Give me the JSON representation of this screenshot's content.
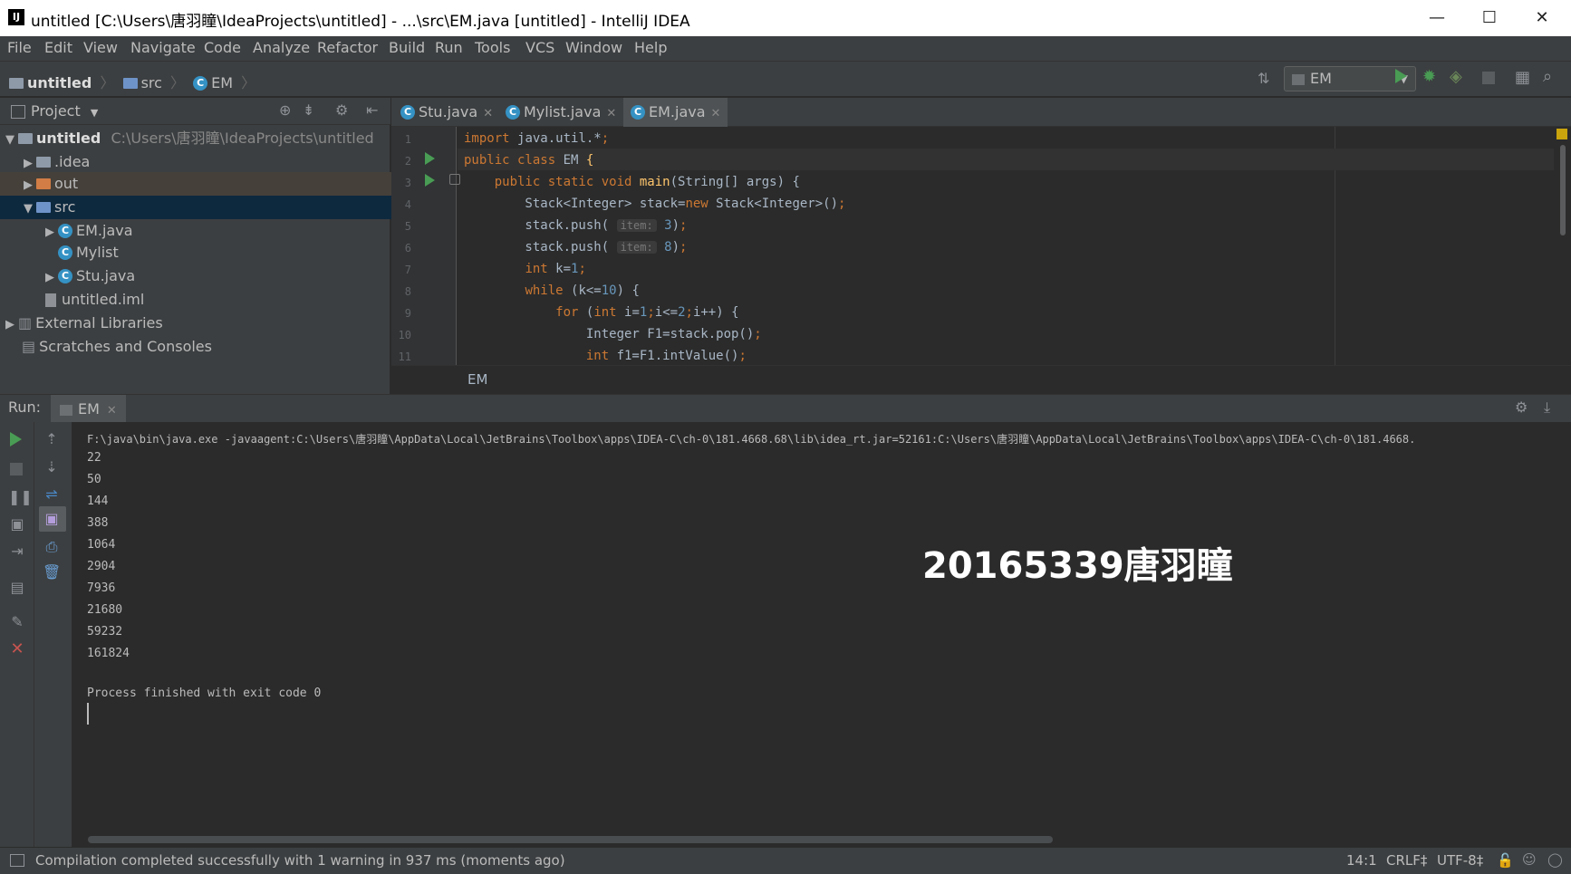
{
  "window": {
    "title": "untitled [C:\\Users\\唐羽瞳\\IdeaProjects\\untitled] - ...\\src\\EM.java [untitled] - IntelliJ IDEA",
    "minimize": "—",
    "maximize": "☐",
    "close": "✕"
  },
  "menu": [
    "File",
    "Edit",
    "View",
    "Navigate",
    "Code",
    "Analyze",
    "Refactor",
    "Build",
    "Run",
    "Tools",
    "VCS",
    "Window",
    "Help"
  ],
  "navbar": {
    "crumbs": [
      "untitled",
      "src",
      "EM"
    ],
    "run_config": "EM"
  },
  "project": {
    "header": "Project",
    "tree": [
      {
        "label": "untitled",
        "path": "C:\\Users\\唐羽瞳\\IdeaProjects\\untitled"
      },
      {
        "label": ".idea"
      },
      {
        "label": "out"
      },
      {
        "label": "src"
      },
      {
        "label": "EM.java"
      },
      {
        "label": "Mylist"
      },
      {
        "label": "Stu.java"
      },
      {
        "label": "untitled.iml"
      },
      {
        "label": "External Libraries"
      },
      {
        "label": "Scratches and Consoles"
      }
    ]
  },
  "editor": {
    "tabs": [
      "Stu.java",
      "Mylist.java",
      "EM.java"
    ],
    "active_tab": "EM.java",
    "line_numbers": [
      "1",
      "2",
      "3",
      "4",
      "5",
      "6",
      "7",
      "8",
      "9",
      "10",
      "11"
    ],
    "hints": {
      "item": "item:"
    },
    "breadcrumb": "EM"
  },
  "run": {
    "label": "Run:",
    "tab": "EM",
    "command": "F:\\java\\bin\\java.exe -javaagent:C:\\Users\\唐羽瞳\\AppData\\Local\\JetBrains\\Toolbox\\apps\\IDEA-C\\ch-0\\181.4668.68\\lib\\idea_rt.jar=52161:C:\\Users\\唐羽瞳\\AppData\\Local\\JetBrains\\Toolbox\\apps\\IDEA-C\\ch-0\\181.4668.",
    "output": [
      "22",
      "50",
      "144",
      "388",
      "1064",
      "2904",
      "7936",
      "21680",
      "59232",
      "161824"
    ],
    "finished": "Process finished with exit code 0",
    "watermark": "20165339唐羽瞳"
  },
  "status": {
    "message": "Compilation completed successfully with 1 warning in 937 ms (moments ago)",
    "position": "14:1",
    "line_sep": "CRLF‡",
    "encoding": "UTF-8‡"
  },
  "colors": {
    "accent": "#4a88c7",
    "keyword": "#cc7832",
    "number": "#6897bb",
    "function": "#ffc66d",
    "run_green": "#499c54"
  }
}
